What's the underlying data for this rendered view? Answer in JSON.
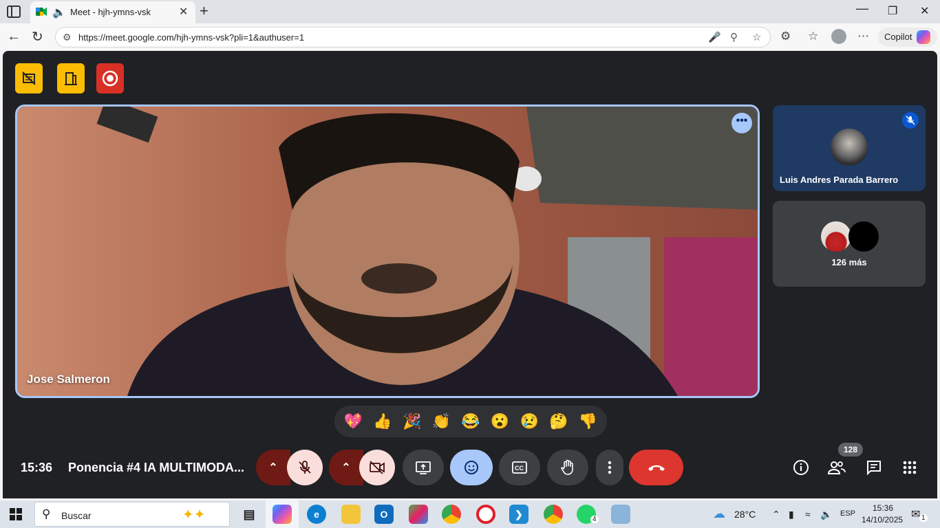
{
  "browser": {
    "tab_title": "Meet - hjh-ymns-vsk",
    "url": "https://meet.google.com/hjh-ymns-vsk?pli=1&authuser=1",
    "copilot_label": "Copilot"
  },
  "meet": {
    "main_speaker": "Jose Salmeron",
    "side_participant": "Luis Andres Parada Barrero",
    "others_label": "126 más",
    "reactions": [
      "💖",
      "👍",
      "🎉",
      "👏",
      "😂",
      "😮",
      "😢",
      "🤔",
      "👎"
    ],
    "clock": "15:36",
    "meeting_title": "Ponencia #4 IA MULTIMODA...",
    "participants_count": "128",
    "colors": {
      "accent_blue": "#a8c7fa",
      "end_call_red": "#dc362e",
      "host_yellow": "#fbbc04",
      "record_red": "#d93025"
    }
  },
  "taskbar": {
    "search_placeholder": "Buscar",
    "weather": "28°C",
    "language": "ESP",
    "time": "15:36",
    "date": "14/10/2025",
    "whatsapp_badge": "4",
    "notification_badge": "1"
  }
}
